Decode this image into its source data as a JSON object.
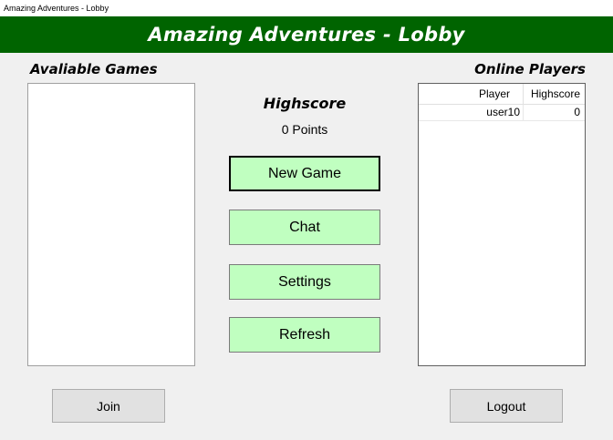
{
  "window": {
    "title": "Amazing Adventures - Lobby"
  },
  "header": {
    "title": "Amazing Adventures - Lobby"
  },
  "games": {
    "label": "Avaliable Games",
    "items": []
  },
  "highscore": {
    "title": "Highscore",
    "value": "0 Points"
  },
  "menu": {
    "new_game": "New Game",
    "chat": "Chat",
    "settings": "Settings",
    "refresh": "Refresh"
  },
  "players": {
    "label": "Online Players",
    "columns": [
      "Player",
      "Highscore"
    ],
    "rows": [
      {
        "player": "user10",
        "highscore": "0"
      }
    ]
  },
  "bottom": {
    "join": "Join",
    "logout": "Logout"
  },
  "colors": {
    "header_bg": "#006400",
    "button_green": "#c0ffc0"
  }
}
